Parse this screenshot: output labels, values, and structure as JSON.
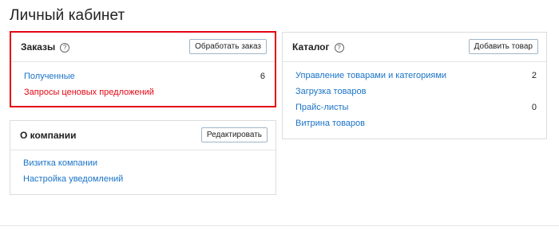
{
  "page": {
    "title": "Личный кабинет"
  },
  "orders": {
    "title": "Заказы",
    "help_icon": "?",
    "button_label": "Обработать заказ",
    "items": [
      {
        "label": "Полученные",
        "count": "6"
      },
      {
        "label": "Запросы ценовых предложений",
        "count": ""
      }
    ],
    "highlight_color": "#e30613"
  },
  "catalog": {
    "title": "Каталог",
    "help_icon": "?",
    "button_label": "Добавить товар",
    "items": [
      {
        "label": "Управление товарами и категориями",
        "count": "2"
      },
      {
        "label": "Загрузка товаров",
        "count": ""
      },
      {
        "label": "Прайс-листы",
        "count": "0"
      },
      {
        "label": "Витрина товаров",
        "count": ""
      }
    ]
  },
  "company": {
    "title": "О компании",
    "button_label": "Редактировать",
    "items": [
      {
        "label": "Визитка компании"
      },
      {
        "label": "Настройка уведомлений"
      }
    ]
  },
  "colors": {
    "link": "#1a73c7",
    "alert": "#e30613",
    "border": "#dcdcdc"
  }
}
